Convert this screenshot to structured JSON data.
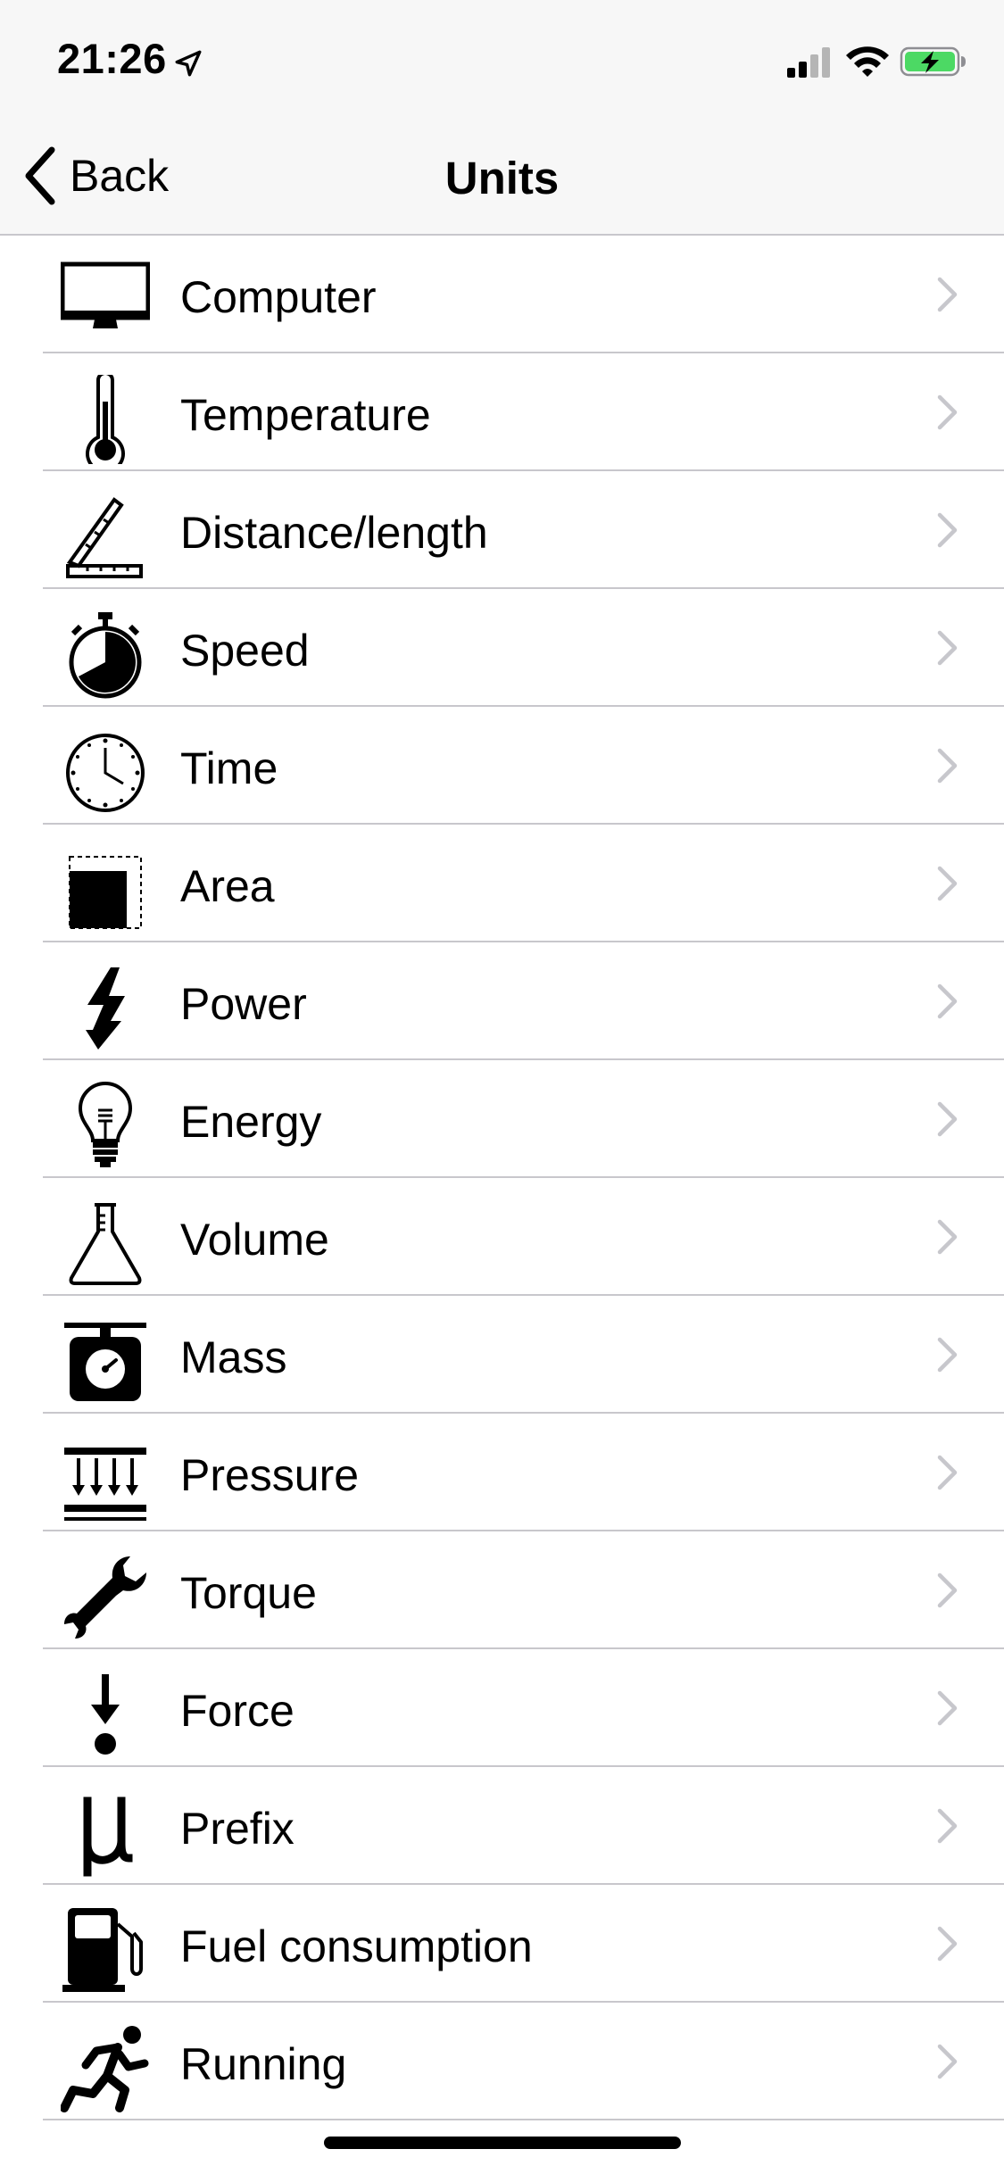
{
  "status_bar": {
    "time": "21:26"
  },
  "nav": {
    "back_label": "Back",
    "title": "Units"
  },
  "items": [
    {
      "label": "Computer",
      "icon": "computer-icon"
    },
    {
      "label": "Temperature",
      "icon": "thermometer-icon"
    },
    {
      "label": "Distance/length",
      "icon": "ruler-icon"
    },
    {
      "label": "Speed",
      "icon": "stopwatch-icon"
    },
    {
      "label": "Time",
      "icon": "clock-icon"
    },
    {
      "label": "Area",
      "icon": "area-icon"
    },
    {
      "label": "Power",
      "icon": "lightning-icon"
    },
    {
      "label": "Energy",
      "icon": "lightbulb-icon"
    },
    {
      "label": "Volume",
      "icon": "flask-icon"
    },
    {
      "label": "Mass",
      "icon": "scale-icon"
    },
    {
      "label": "Pressure",
      "icon": "pressure-icon"
    },
    {
      "label": "Torque",
      "icon": "wrench-icon"
    },
    {
      "label": "Force",
      "icon": "force-icon"
    },
    {
      "label": "Prefix",
      "icon": "mu-icon"
    },
    {
      "label": "Fuel consumption",
      "icon": "fuel-pump-icon"
    },
    {
      "label": "Running",
      "icon": "runner-icon"
    }
  ],
  "colors": {
    "nav_background": "#f7f7f7",
    "separator": "#c8c7cc",
    "chevron": "#c7c7cc",
    "battery_fill": "#4cd964"
  }
}
